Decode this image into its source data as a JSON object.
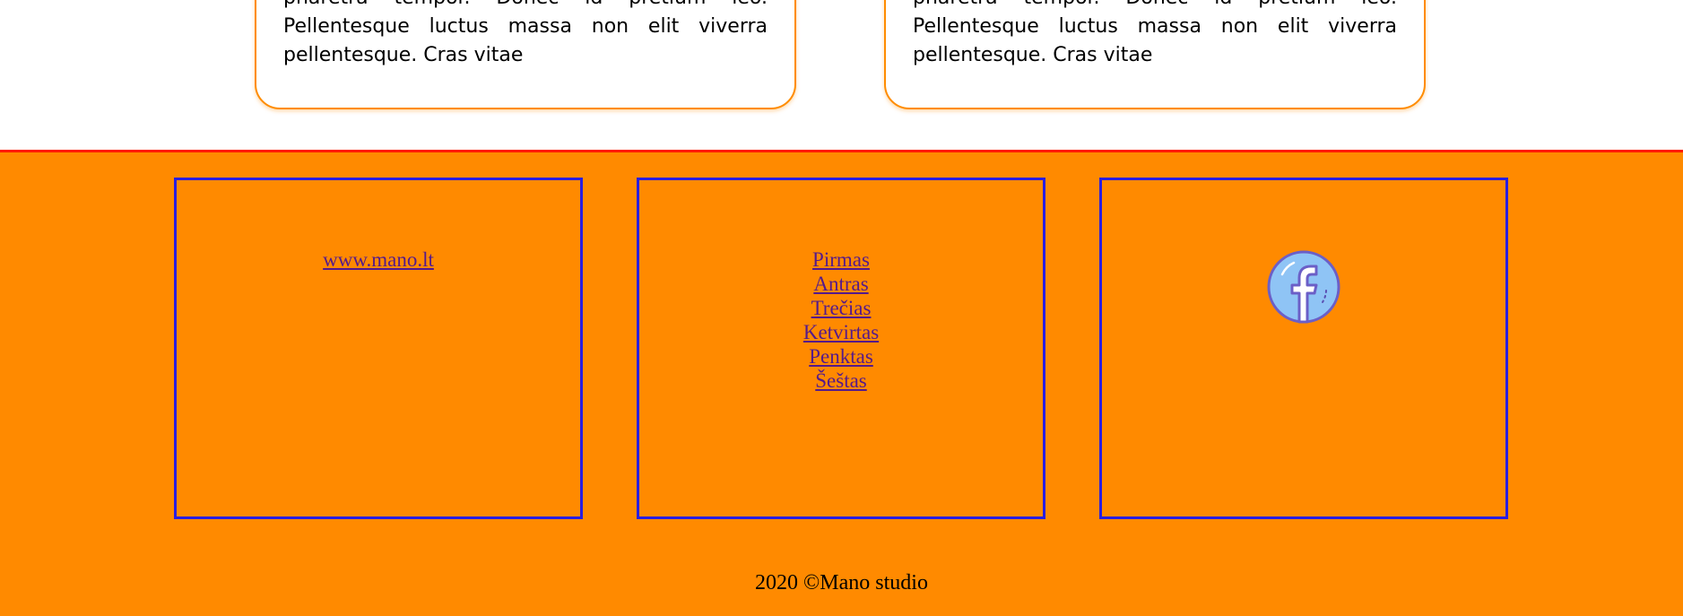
{
  "cards": [
    {
      "text": "pharetra tempor. Donec id pretium leo. Pellentesque luctus massa non elit viverra pellentesque. Cras vitae"
    },
    {
      "text": "pharetra tempor. Donec id pretium leo. Pellentesque luctus massa non elit viverra pellentesque. Cras vitae"
    }
  ],
  "footer": {
    "site_link": "www.mano.lt",
    "nav_links": [
      "Pirmas",
      "Antras",
      "Trečias",
      "Ketvirtas",
      "Penktas",
      "Šeštas"
    ],
    "social_icon": "facebook-icon",
    "copyright": "2020 ©Mano studio"
  },
  "colors": {
    "footer_background": "#ff8a00",
    "footer_border_top": "#ff1a00",
    "box_border": "#2a1ee0",
    "link": "#551a8b",
    "card_border": "#ff8c00"
  }
}
